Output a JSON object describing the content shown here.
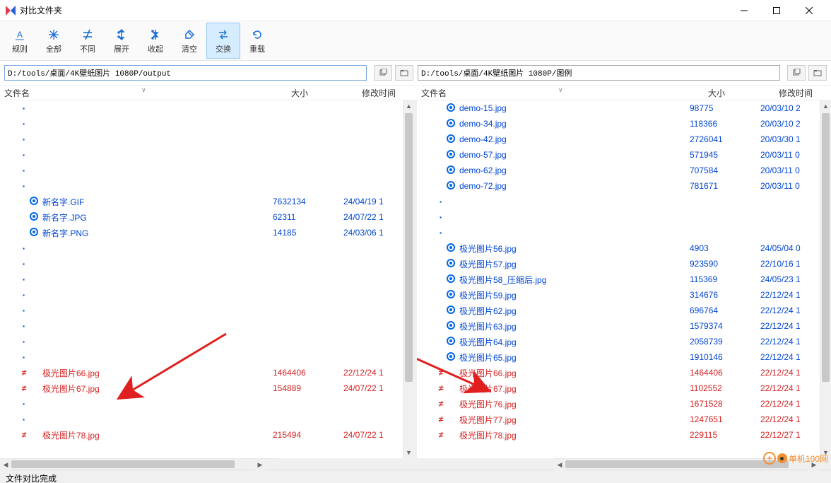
{
  "window": {
    "title": "对比文件夹"
  },
  "toolbar": [
    {
      "id": "rules",
      "label": "规则",
      "icon": "A"
    },
    {
      "id": "all",
      "label": "全部",
      "icon": "star"
    },
    {
      "id": "diff",
      "label": "不同",
      "icon": "neq"
    },
    {
      "id": "expand",
      "label": "展开",
      "icon": "expand"
    },
    {
      "id": "collapse",
      "label": "收起",
      "icon": "collapse"
    },
    {
      "id": "clear",
      "label": "清空",
      "icon": "clear"
    },
    {
      "id": "swap",
      "label": "交换",
      "icon": "swap",
      "active": true
    },
    {
      "id": "reload",
      "label": "重载",
      "icon": "reload"
    }
  ],
  "paths": {
    "left": "D:/tools/桌面/4K壁纸图片 1080P/output",
    "right": "D:/tools/桌面/4K壁纸图片 1080P/图例"
  },
  "columns": {
    "name": "文件名",
    "size": "大小",
    "date": "修改时间"
  },
  "left_rows": [
    {
      "t": "dot"
    },
    {
      "t": "dot"
    },
    {
      "t": "dot"
    },
    {
      "t": "dot"
    },
    {
      "t": "dot"
    },
    {
      "t": "dot"
    },
    {
      "t": "blue",
      "ico": 1,
      "name": "新名字.GIF",
      "size": "7632134",
      "date": "24/04/19 1"
    },
    {
      "t": "blue",
      "ico": 1,
      "name": "新名字.JPG",
      "size": "62311",
      "date": "24/07/22 1"
    },
    {
      "t": "blue",
      "ico": 1,
      "name": "新名字.PNG",
      "size": "14185",
      "date": "24/03/06 1"
    },
    {
      "t": "dot"
    },
    {
      "t": "dot"
    },
    {
      "t": "dot"
    },
    {
      "t": "dot"
    },
    {
      "t": "dot"
    },
    {
      "t": "dot"
    },
    {
      "t": "dot"
    },
    {
      "t": "dot"
    },
    {
      "t": "red",
      "mark": "≠",
      "name": "极光图片66.jpg",
      "size": "1464406",
      "date": "22/12/24 1"
    },
    {
      "t": "red",
      "mark": "≠",
      "name": "极光图片67.jpg",
      "size": "154889",
      "date": "24/07/22 1"
    },
    {
      "t": "dot"
    },
    {
      "t": "dot"
    },
    {
      "t": "red",
      "mark": "≠",
      "name": "极光图片78.jpg",
      "size": "215494",
      "date": "24/07/22 1"
    }
  ],
  "right_rows": [
    {
      "t": "blue",
      "ico": 1,
      "name": "demo-15.jpg",
      "size": "98775",
      "date": "20/03/10 2"
    },
    {
      "t": "blue",
      "ico": 1,
      "name": "demo-34.jpg",
      "size": "118366",
      "date": "20/03/10 2"
    },
    {
      "t": "blue",
      "ico": 1,
      "name": "demo-42.jpg",
      "size": "2726041",
      "date": "20/03/30 1"
    },
    {
      "t": "blue",
      "ico": 1,
      "name": "demo-57.jpg",
      "size": "571945",
      "date": "20/03/11 0"
    },
    {
      "t": "blue",
      "ico": 1,
      "name": "demo-62.jpg",
      "size": "707584",
      "date": "20/03/11 0"
    },
    {
      "t": "blue",
      "ico": 1,
      "name": "demo-72.jpg",
      "size": "781671",
      "date": "20/03/11 0"
    },
    {
      "t": "dot"
    },
    {
      "t": "dot"
    },
    {
      "t": "dot"
    },
    {
      "t": "blue",
      "ico": 1,
      "name": "极光图片56.jpg",
      "size": "4903",
      "date": "24/05/04 0"
    },
    {
      "t": "blue",
      "ico": 1,
      "name": "极光图片57.jpg",
      "size": "923590",
      "date": "22/10/16 1"
    },
    {
      "t": "blue",
      "ico": 1,
      "name": "极光图片58_压缩后.jpg",
      "size": "115369",
      "date": "24/05/23 1"
    },
    {
      "t": "blue",
      "ico": 1,
      "name": "极光图片59.jpg",
      "size": "314676",
      "date": "22/12/24 1"
    },
    {
      "t": "blue",
      "ico": 1,
      "name": "极光图片62.jpg",
      "size": "696764",
      "date": "22/12/24 1"
    },
    {
      "t": "blue",
      "ico": 1,
      "name": "极光图片63.jpg",
      "size": "1579374",
      "date": "22/12/24 1"
    },
    {
      "t": "blue",
      "ico": 1,
      "name": "极光图片64.jpg",
      "size": "2058739",
      "date": "22/12/24 1"
    },
    {
      "t": "blue",
      "ico": 1,
      "name": "极光图片65.jpg",
      "size": "1910146",
      "date": "22/12/24 1"
    },
    {
      "t": "red",
      "mark": "≠",
      "name": "极光图片66.jpg",
      "size": "1464406",
      "date": "22/12/24 1"
    },
    {
      "t": "red",
      "mark": "≠",
      "name": "极光图片67.jpg",
      "size": "1102552",
      "date": "22/12/24 1"
    },
    {
      "t": "red",
      "mark": "≠",
      "name": "极光图片76.jpg",
      "size": "1671528",
      "date": "22/12/24 1"
    },
    {
      "t": "red",
      "mark": "≠",
      "name": "极光图片77.jpg",
      "size": "1247651",
      "date": "22/12/24 1"
    },
    {
      "t": "red",
      "mark": "≠",
      "name": "极光图片78.jpg",
      "size": "229115",
      "date": "22/12/27 1"
    }
  ],
  "status": "文件对比完成",
  "watermark": "单机100网"
}
